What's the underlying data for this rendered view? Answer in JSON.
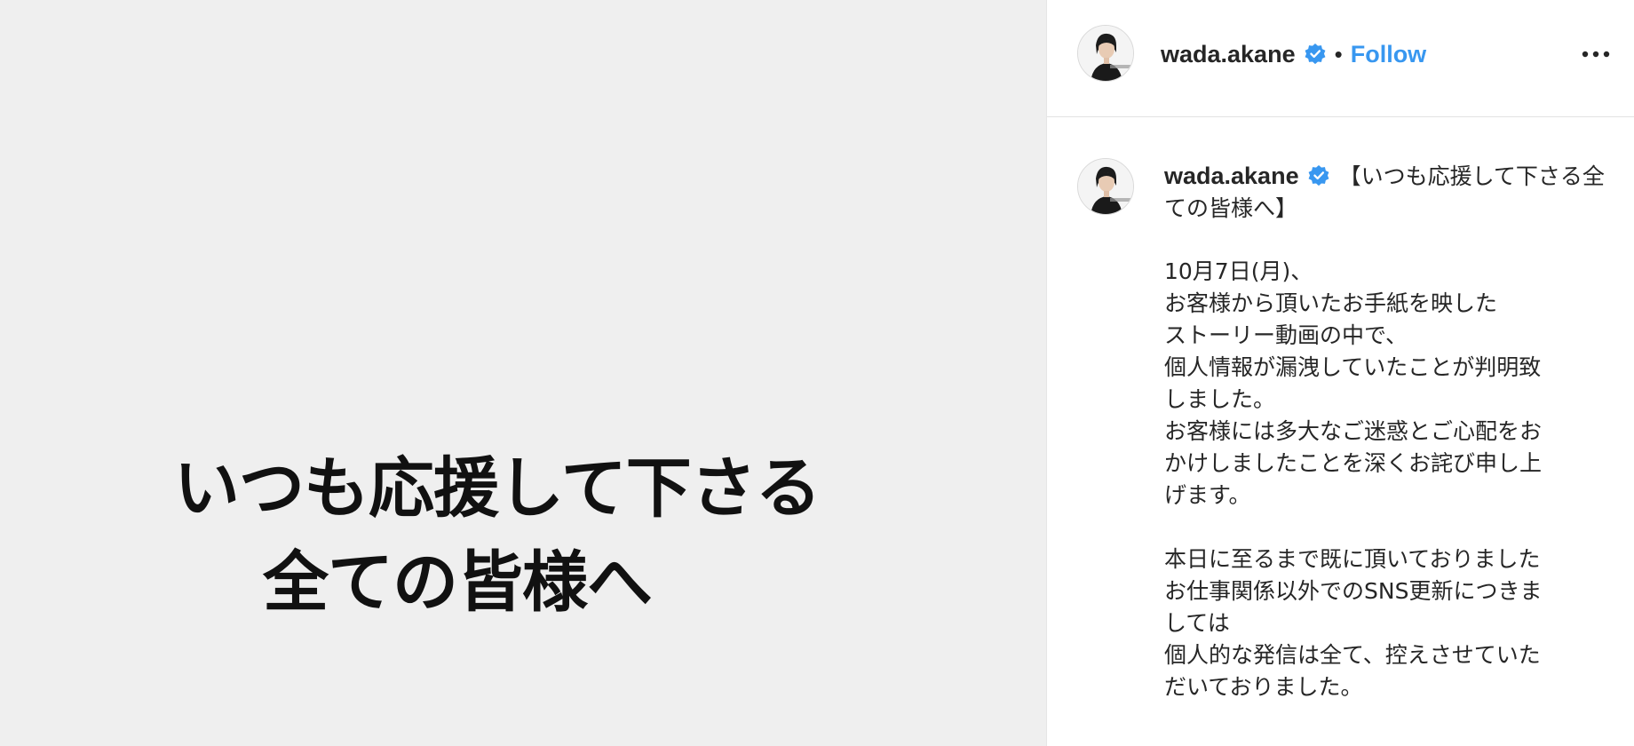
{
  "media": {
    "line1": "いつも応援して下さる",
    "line2": "全ての皆様へ",
    "background": "#efefef"
  },
  "header": {
    "username": "wada.akane",
    "separator": "•",
    "follow_label": "Follow",
    "more_icon": "more-horizontal-icon",
    "verified_icon": "verified-badge-icon"
  },
  "caption": {
    "username": "wada.akane",
    "title": "【いつも応援して下さる全ての皆様へ】",
    "lines": [
      "10月7日(月)、",
      "お客様から頂いたお手紙を映した",
      "ストーリー動画の中で、",
      "個人情報が漏洩していたことが判明致",
      "しました。",
      "お客様には多大なご迷惑とご心配をお",
      "かけしましたことを深くお詫び申し上",
      "げます。",
      "",
      "本日に至るまで既に頂いておりました",
      "お仕事関係以外でのSNS更新につきま",
      "しては",
      "個人的な発信は全て、控えさせていた",
      "だいておりました。"
    ]
  },
  "colors": {
    "accent": "#3897f0",
    "text": "#262626",
    "verified": "#3897f0"
  }
}
